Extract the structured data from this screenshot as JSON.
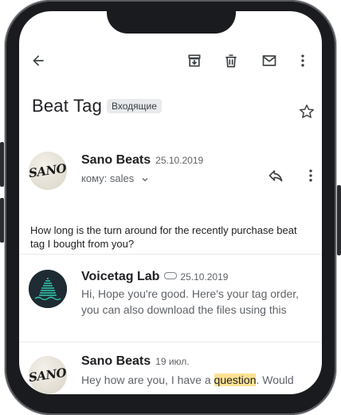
{
  "toolbar": {
    "back": "arrow-back-icon",
    "archive": "archive-icon",
    "delete": "trash-icon",
    "mark_unread": "mail-icon",
    "more": "more-vert-icon"
  },
  "thread": {
    "subject": "Beat Tag",
    "label": "Входящие"
  },
  "messages": [
    {
      "sender": "Sano Beats",
      "date": "25.10.2019",
      "to": "кому: sales",
      "avatar_text": "SANO",
      "body": "How long is the turn around for the recently purchase beat tag I bought from you?"
    },
    {
      "sender": "Voicetag Lab",
      "date": "25.10.2019",
      "snippet": "Hi, Hope you're good. Here's your tag order, you can also download the files using this"
    },
    {
      "sender": "Sano Beats",
      "date": "19 июл.",
      "avatar_text": "SANO",
      "snippet_before": "Hey how are you, I have a ",
      "snippet_highlight": "question",
      "snippet_after": ". Would"
    }
  ],
  "colors": {
    "highlight": "#fde293",
    "frame": "#1a1b1e"
  }
}
